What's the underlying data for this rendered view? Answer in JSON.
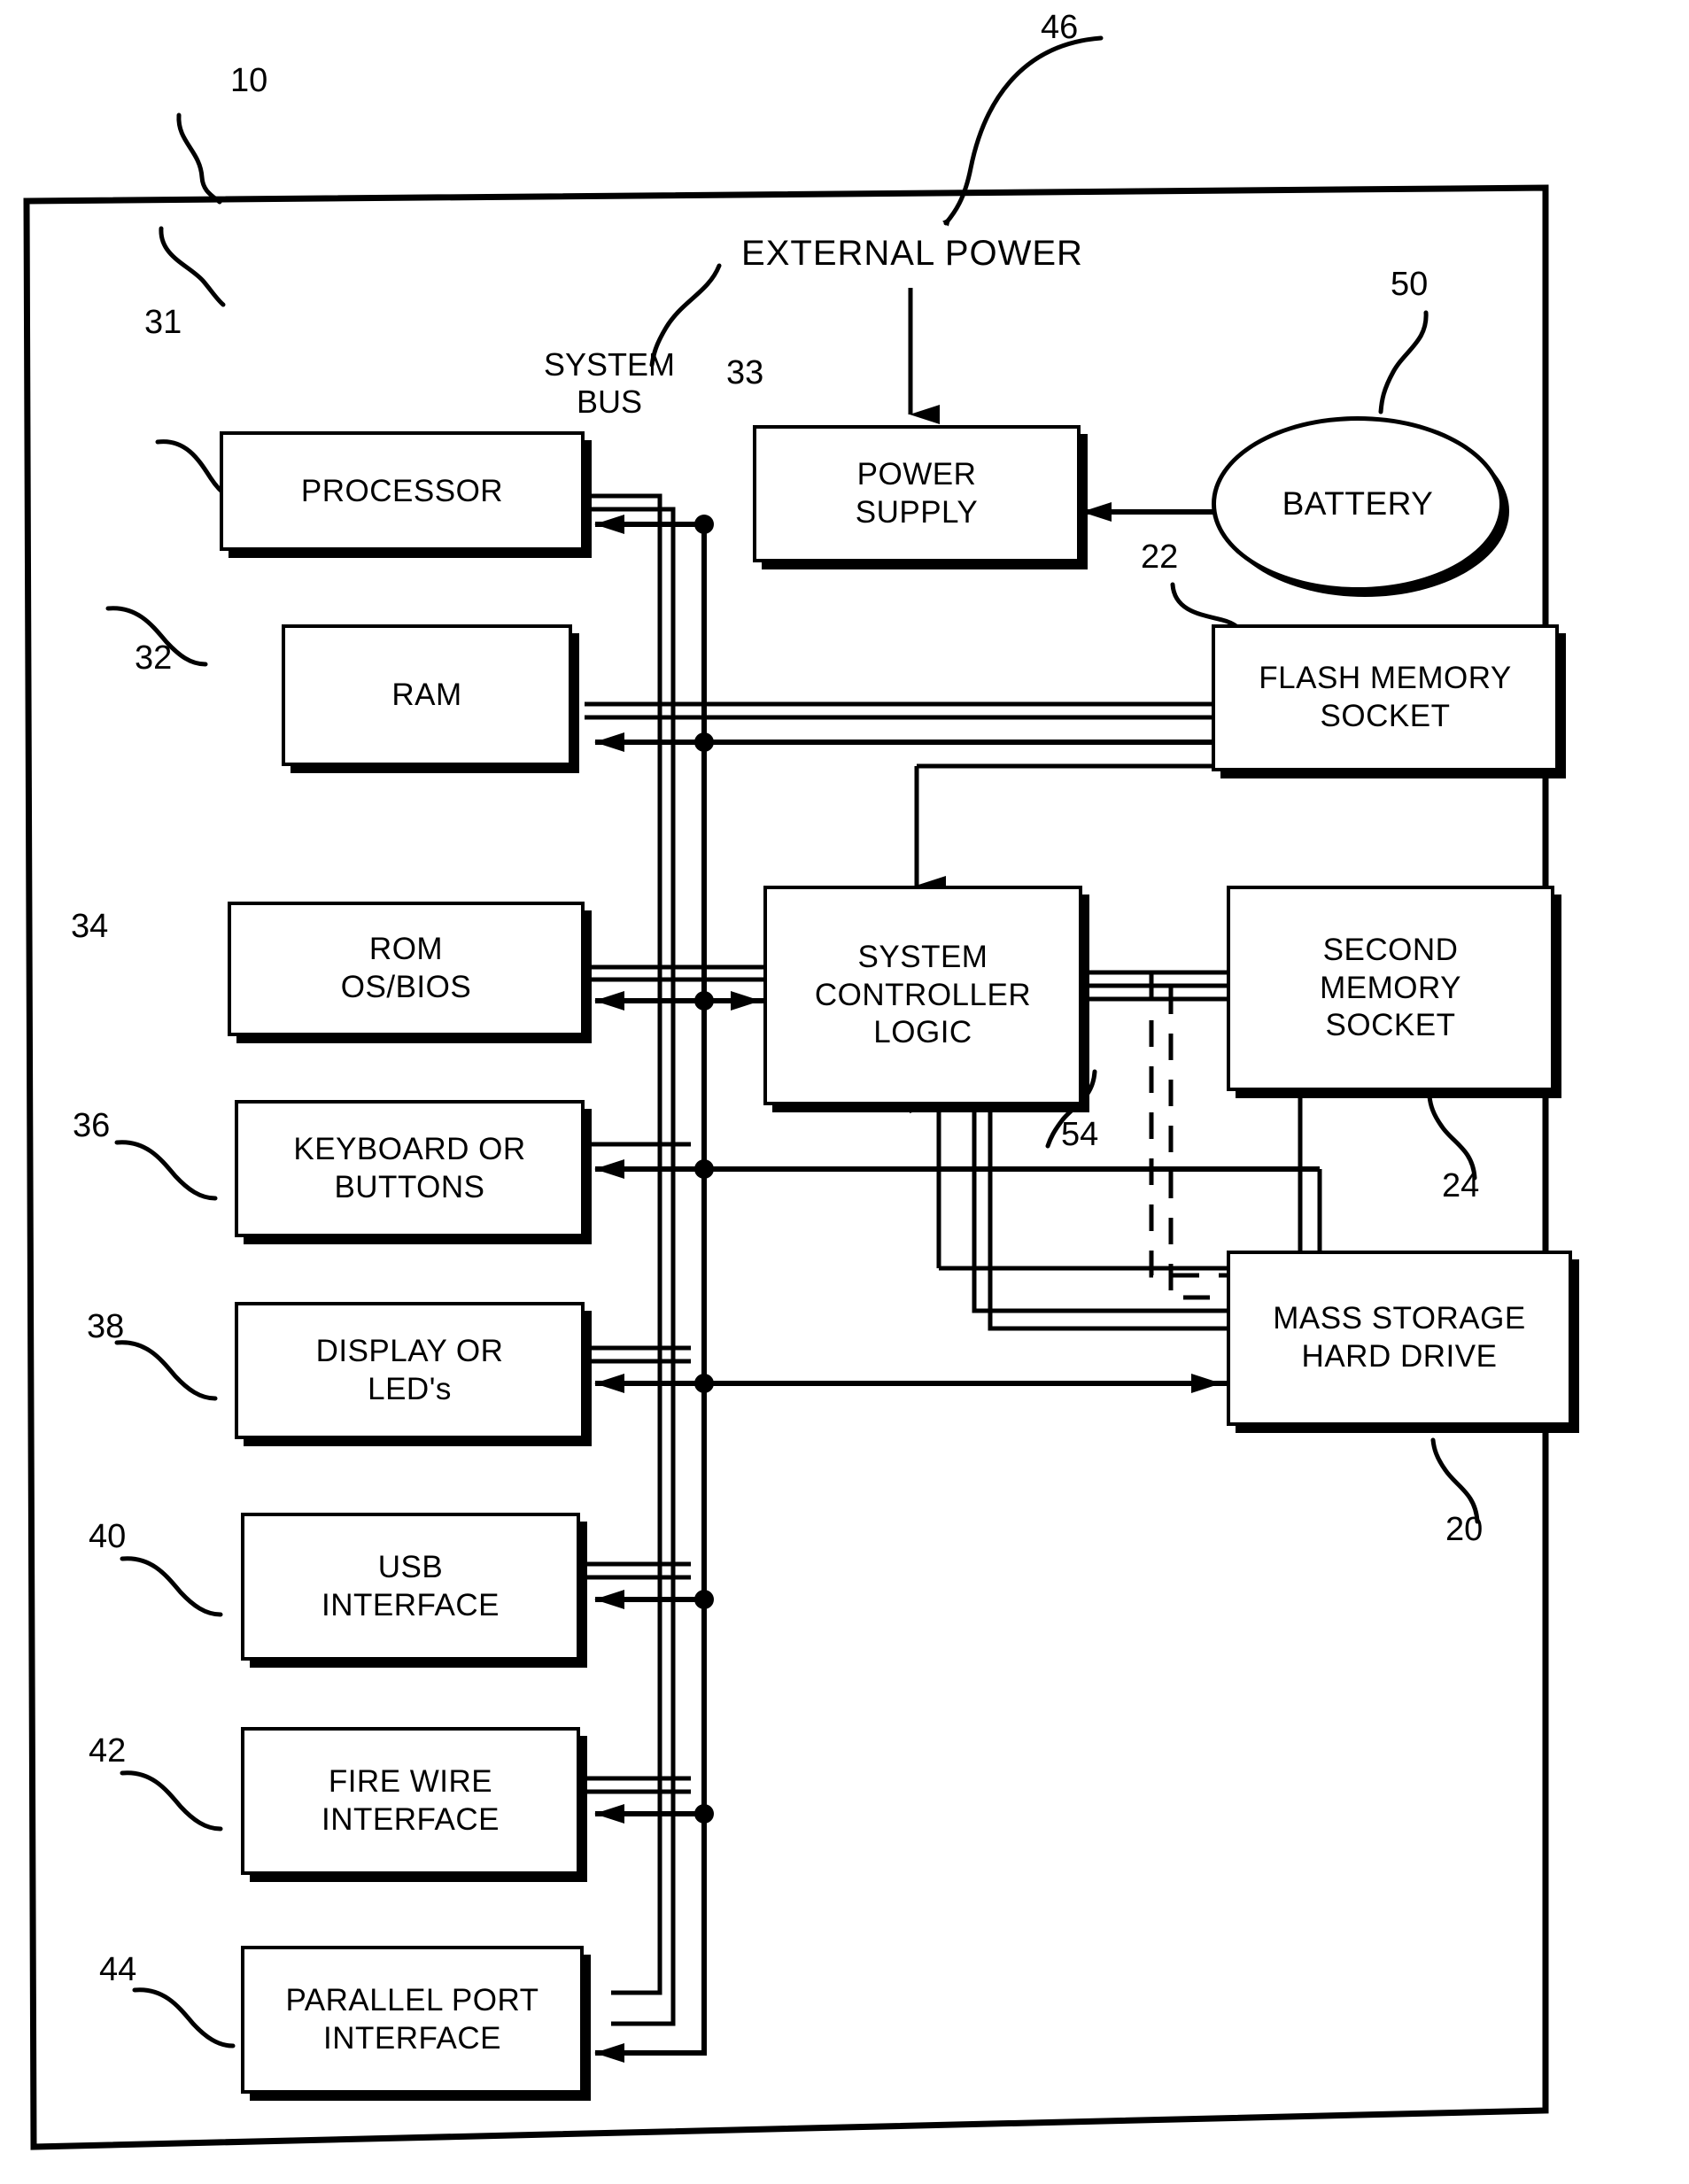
{
  "figure": {
    "outer_ref": "10",
    "external_power_label": "EXTERNAL POWER",
    "external_power_ref": "46",
    "system_bus_label_line1": "SYSTEM",
    "system_bus_label_line2": "BUS",
    "system_bus_ref": "33"
  },
  "blocks": {
    "processor": {
      "ref": "31",
      "line1": "PROCESSOR",
      "line2": ""
    },
    "ram": {
      "ref": "32",
      "line1": "RAM",
      "line2": ""
    },
    "rom": {
      "ref": "34",
      "line1": "ROM",
      "line2": "OS/BIOS"
    },
    "keyboard": {
      "ref": "36",
      "line1": "KEYBOARD OR",
      "line2": "BUTTONS"
    },
    "display": {
      "ref": "38",
      "line1": "DISPLAY  OR",
      "line2": "LED's"
    },
    "usb": {
      "ref": "40",
      "line1": "USB",
      "line2": "INTERFACE"
    },
    "firewire": {
      "ref": "42",
      "line1": "FIRE WIRE",
      "line2": "INTERFACE"
    },
    "parallel": {
      "ref": "44",
      "line1": "PARALLEL PORT",
      "line2": "INTERFACE"
    },
    "power_supply": {
      "ref": "",
      "line1": "POWER",
      "line2": "SUPPLY"
    },
    "battery": {
      "ref": "50",
      "line1": "BATTERY",
      "line2": ""
    },
    "flash_socket": {
      "ref": "22",
      "line1": "FLASH MEMORY",
      "line2": "SOCKET"
    },
    "controller": {
      "ref": "54",
      "line1": "SYSTEM",
      "line2": "CONTROLLER",
      "line3": "LOGIC"
    },
    "second_socket": {
      "ref": "24",
      "line1": "SECOND",
      "line2": "MEMORY",
      "line3": "SOCKET"
    },
    "mass_storage": {
      "ref": "20",
      "line1": "MASS STORAGE",
      "line2": "HARD DRIVE"
    }
  },
  "colors": {
    "ink": "#000000",
    "paper": "#ffffff"
  }
}
